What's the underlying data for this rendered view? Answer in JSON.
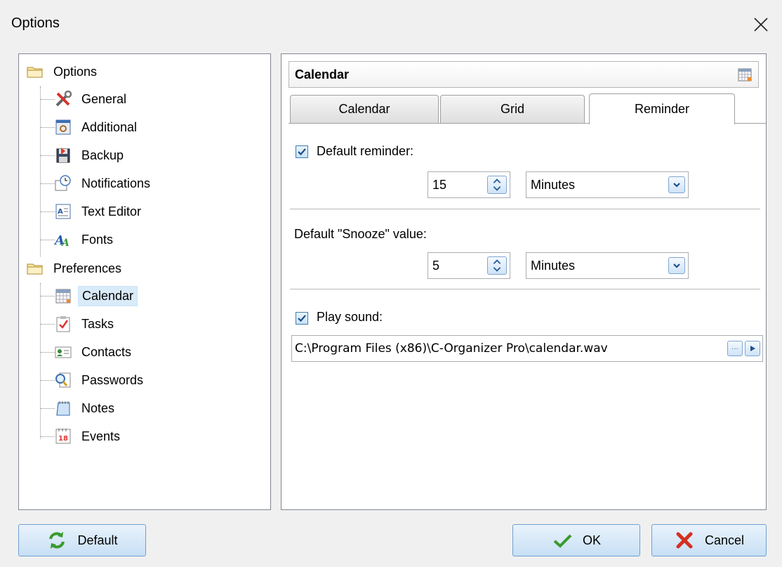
{
  "window": {
    "title": "Options"
  },
  "tree": {
    "groups": [
      {
        "label": "Options",
        "items": [
          "General",
          "Additional",
          "Backup",
          "Notifications",
          "Text Editor",
          "Fonts"
        ]
      },
      {
        "label": "Preferences",
        "items": [
          "Calendar",
          "Tasks",
          "Contacts",
          "Passwords",
          "Notes",
          "Events"
        ]
      }
    ],
    "selected": "Calendar"
  },
  "panel": {
    "title": "Calendar",
    "tabs": [
      "Calendar",
      "Grid",
      "Reminder"
    ],
    "active_tab": "Reminder"
  },
  "reminder": {
    "default_reminder_label": "Default reminder:",
    "default_reminder_checked": true,
    "default_reminder_value": "15",
    "default_reminder_unit": "Minutes",
    "snooze_label": "Default \"Snooze\" value:",
    "snooze_value": "5",
    "snooze_unit": "Minutes",
    "play_sound_label": "Play sound:",
    "play_sound_checked": true,
    "sound_path": "C:\\Program Files (x86)\\C-Organizer Pro\\calendar.wav",
    "browse_label": "···"
  },
  "buttons": {
    "default": "Default",
    "ok": "OK",
    "cancel": "Cancel"
  },
  "colors": {
    "selection": "#d9ebf9",
    "button_gradient_top": "#e9f3fc",
    "button_gradient_bottom": "#c7dff5",
    "button_border": "#6f9fcf"
  }
}
